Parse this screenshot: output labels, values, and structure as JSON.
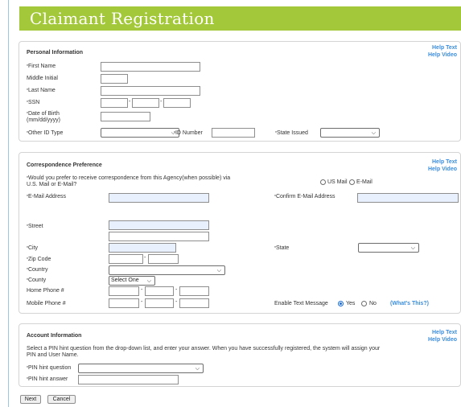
{
  "banner": {
    "title": "Claimant Registration"
  },
  "personal": {
    "title": "Personal Information",
    "help_text": "Help Text",
    "help_video": "Help Video",
    "first_name": "First Name",
    "middle_initial": "Middle Initial",
    "last_name": "Last Name",
    "ssn": "SSN",
    "dob_line1": "Date of Birth",
    "dob_line2": "(mm/dd/yyyy)",
    "other_id_type": "Other ID Type",
    "id_number": "ID Number",
    "state_issued": "State Issued"
  },
  "correspondence": {
    "title": "Correspondence Preference",
    "help_text": "Help Text",
    "help_video": "Help Video",
    "question_line1": "Would you prefer to receive correspondence from this Agency(when possible) via",
    "question_line2": "U.S. Mail or E-Mail?",
    "us_mail": "US Mail",
    "email": "E-Mail",
    "email_address": "E-Mail Address",
    "confirm_email": "Confirm E-Mail Address",
    "street": "Street",
    "city": "City",
    "state": "State",
    "zip": "Zip Code",
    "country": "Country",
    "county": "County",
    "county_value": "Select One",
    "home_phone": "Home Phone #",
    "mobile_phone": "Mobile Phone #",
    "enable_text": "Enable Text Message",
    "yes": "Yes",
    "no": "No",
    "whats_this": "(What's This?)"
  },
  "account": {
    "title": "Account Information",
    "help_text": "Help Text",
    "help_video": "Help Video",
    "instructions_line1": "Select a PIN hint question from the drop-down list, and enter your answer. When you have successfully registered, the system will assign your",
    "instructions_line2": "PIN and User Name.",
    "pin_question": "PIN hint question",
    "pin_answer": "PIN hint answer"
  },
  "buttons": {
    "next": "Next",
    "cancel": "Cancel"
  },
  "required_marker": "*",
  "icons": {
    "dropdown": "chevron-down-icon",
    "radio": "radio-icon"
  },
  "colors": {
    "banner": "#a3c93a",
    "link": "#3b8ede",
    "autofill": "#e8f0fe"
  }
}
